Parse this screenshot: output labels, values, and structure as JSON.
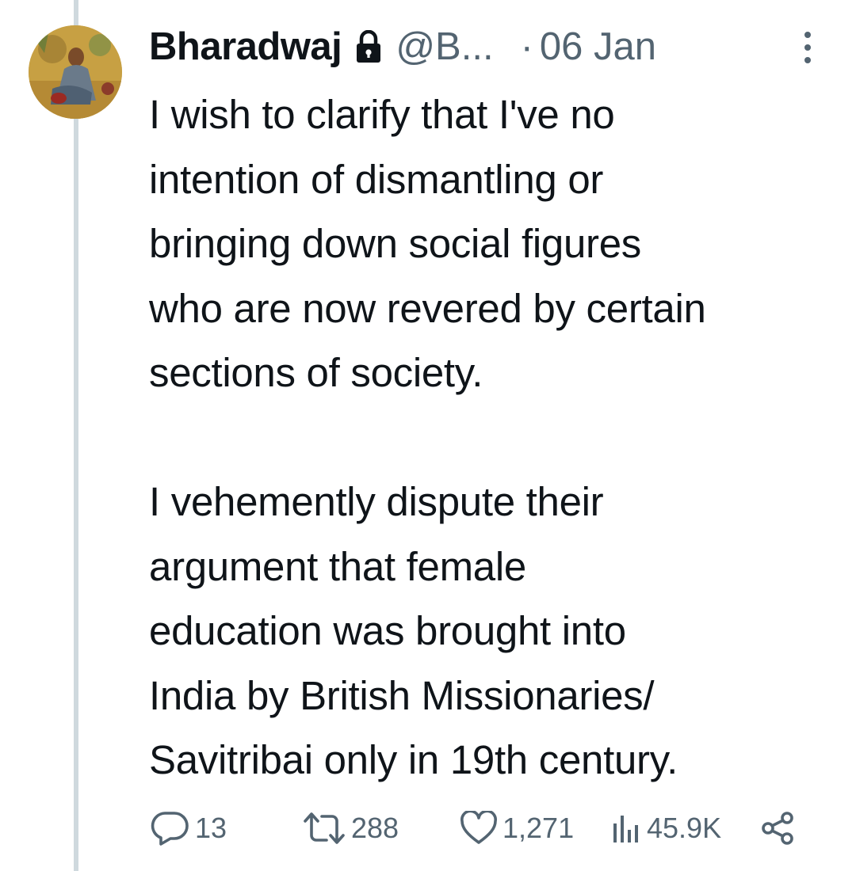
{
  "tweet": {
    "author_name": "Bharadwaj",
    "handle": "@B...",
    "separator": "·",
    "date": "06 Jan",
    "paragraphs": [
      [
        "I wish to clarify that I've no",
        "intention of dismantling or",
        "bringing down social figures",
        "who are now revered by certain",
        "sections of society."
      ],
      [
        "I vehemently dispute their",
        "argument that female",
        "education was brought into",
        "India by British Missionaries/",
        "Savitribai only in 19th century."
      ]
    ]
  },
  "actions": {
    "replies": "13",
    "reposts": "288",
    "likes": "1,271",
    "views": "45.9K"
  },
  "icons": {
    "protected": "lock-icon",
    "more": "more-icon",
    "reply": "reply-icon",
    "repost": "repost-icon",
    "like": "heart-icon",
    "views": "views-icon",
    "share": "share-icon"
  },
  "colors": {
    "text": "#0f1419",
    "secondary": "#536471",
    "thread_line": "#cfd9de"
  }
}
